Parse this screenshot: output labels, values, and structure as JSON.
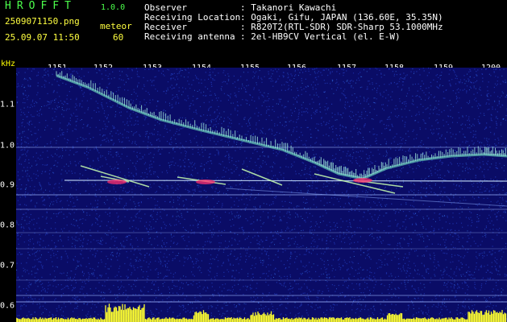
{
  "header": {
    "app_title": "HROFFT",
    "app_version": "1.0.0",
    "file_name": "2509071150.png",
    "mode_label": "meteor",
    "date_time": "25.09.07 11:50",
    "count_value": "60",
    "info": [
      {
        "label": "Observer",
        "value": ": Takanori Kawachi"
      },
      {
        "label": "Receiving Location",
        "value": ": Ogaki, Gifu, JAPAN (136.60E, 35.35N)"
      },
      {
        "label": "Receiver",
        "value": ": R820T2(RTL-SDR) SDR-Sharp 53.1000MHz"
      },
      {
        "label": "Receiving antenna",
        "value": ": 2el-HB9CV Vertical (el. E-W)"
      }
    ]
  },
  "spectrogram": {
    "freq_unit": "kHz",
    "x_ticks": [
      "1151",
      "1152",
      "1153",
      "1154",
      "1155",
      "1156",
      "1157",
      "1158",
      "1159",
      "1200"
    ],
    "y_ticks": [
      "1.1",
      "1.0",
      "0.9",
      "0.8",
      "0.7",
      "0.6"
    ],
    "colors": {
      "background": "#0a0c66",
      "noise": "#2a4bd8",
      "signal": "#7fffd0",
      "hot": "#ff3070",
      "tick_text": "#ffffff",
      "title": "#4cff4c",
      "meta": "#ffff40",
      "bar": "#ffff30"
    }
  }
}
